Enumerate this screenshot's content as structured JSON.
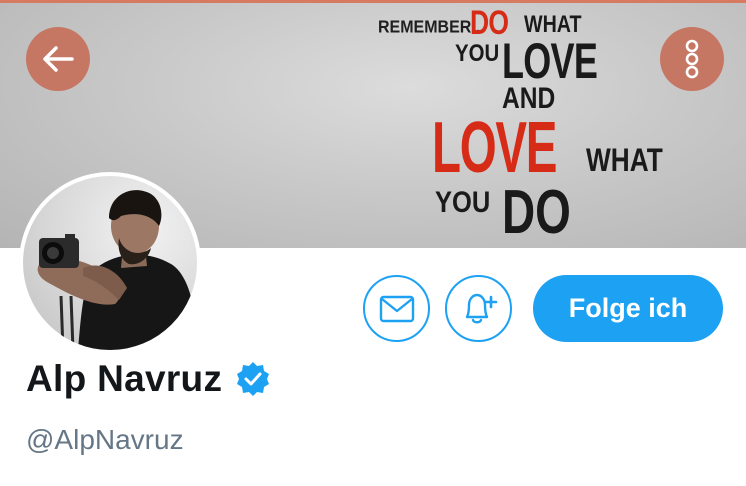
{
  "banner": {
    "quote": {
      "remember": "REMEMBER...",
      "do_1": "DO",
      "what_1": "WHAT",
      "you_1": "YOU",
      "love_1": "LOVE",
      "and": "AND",
      "love_2": "LOVE",
      "what_2": "WHAT",
      "you_2": "YOU",
      "do_2": "DO"
    },
    "accent_color": "#d62b17"
  },
  "header": {
    "back_icon": "arrow-left-icon",
    "more_icon": "vertical-dots-icon",
    "button_color": "#c57763"
  },
  "actions": {
    "message_icon": "envelope-icon",
    "notify_icon": "bell-plus-icon",
    "follow_label": "Folge ich",
    "brand_color": "#1da1f2"
  },
  "profile": {
    "name": "Alp Navruz",
    "handle": "@AlpNavruz",
    "verified_icon": "verified-badge-icon"
  }
}
